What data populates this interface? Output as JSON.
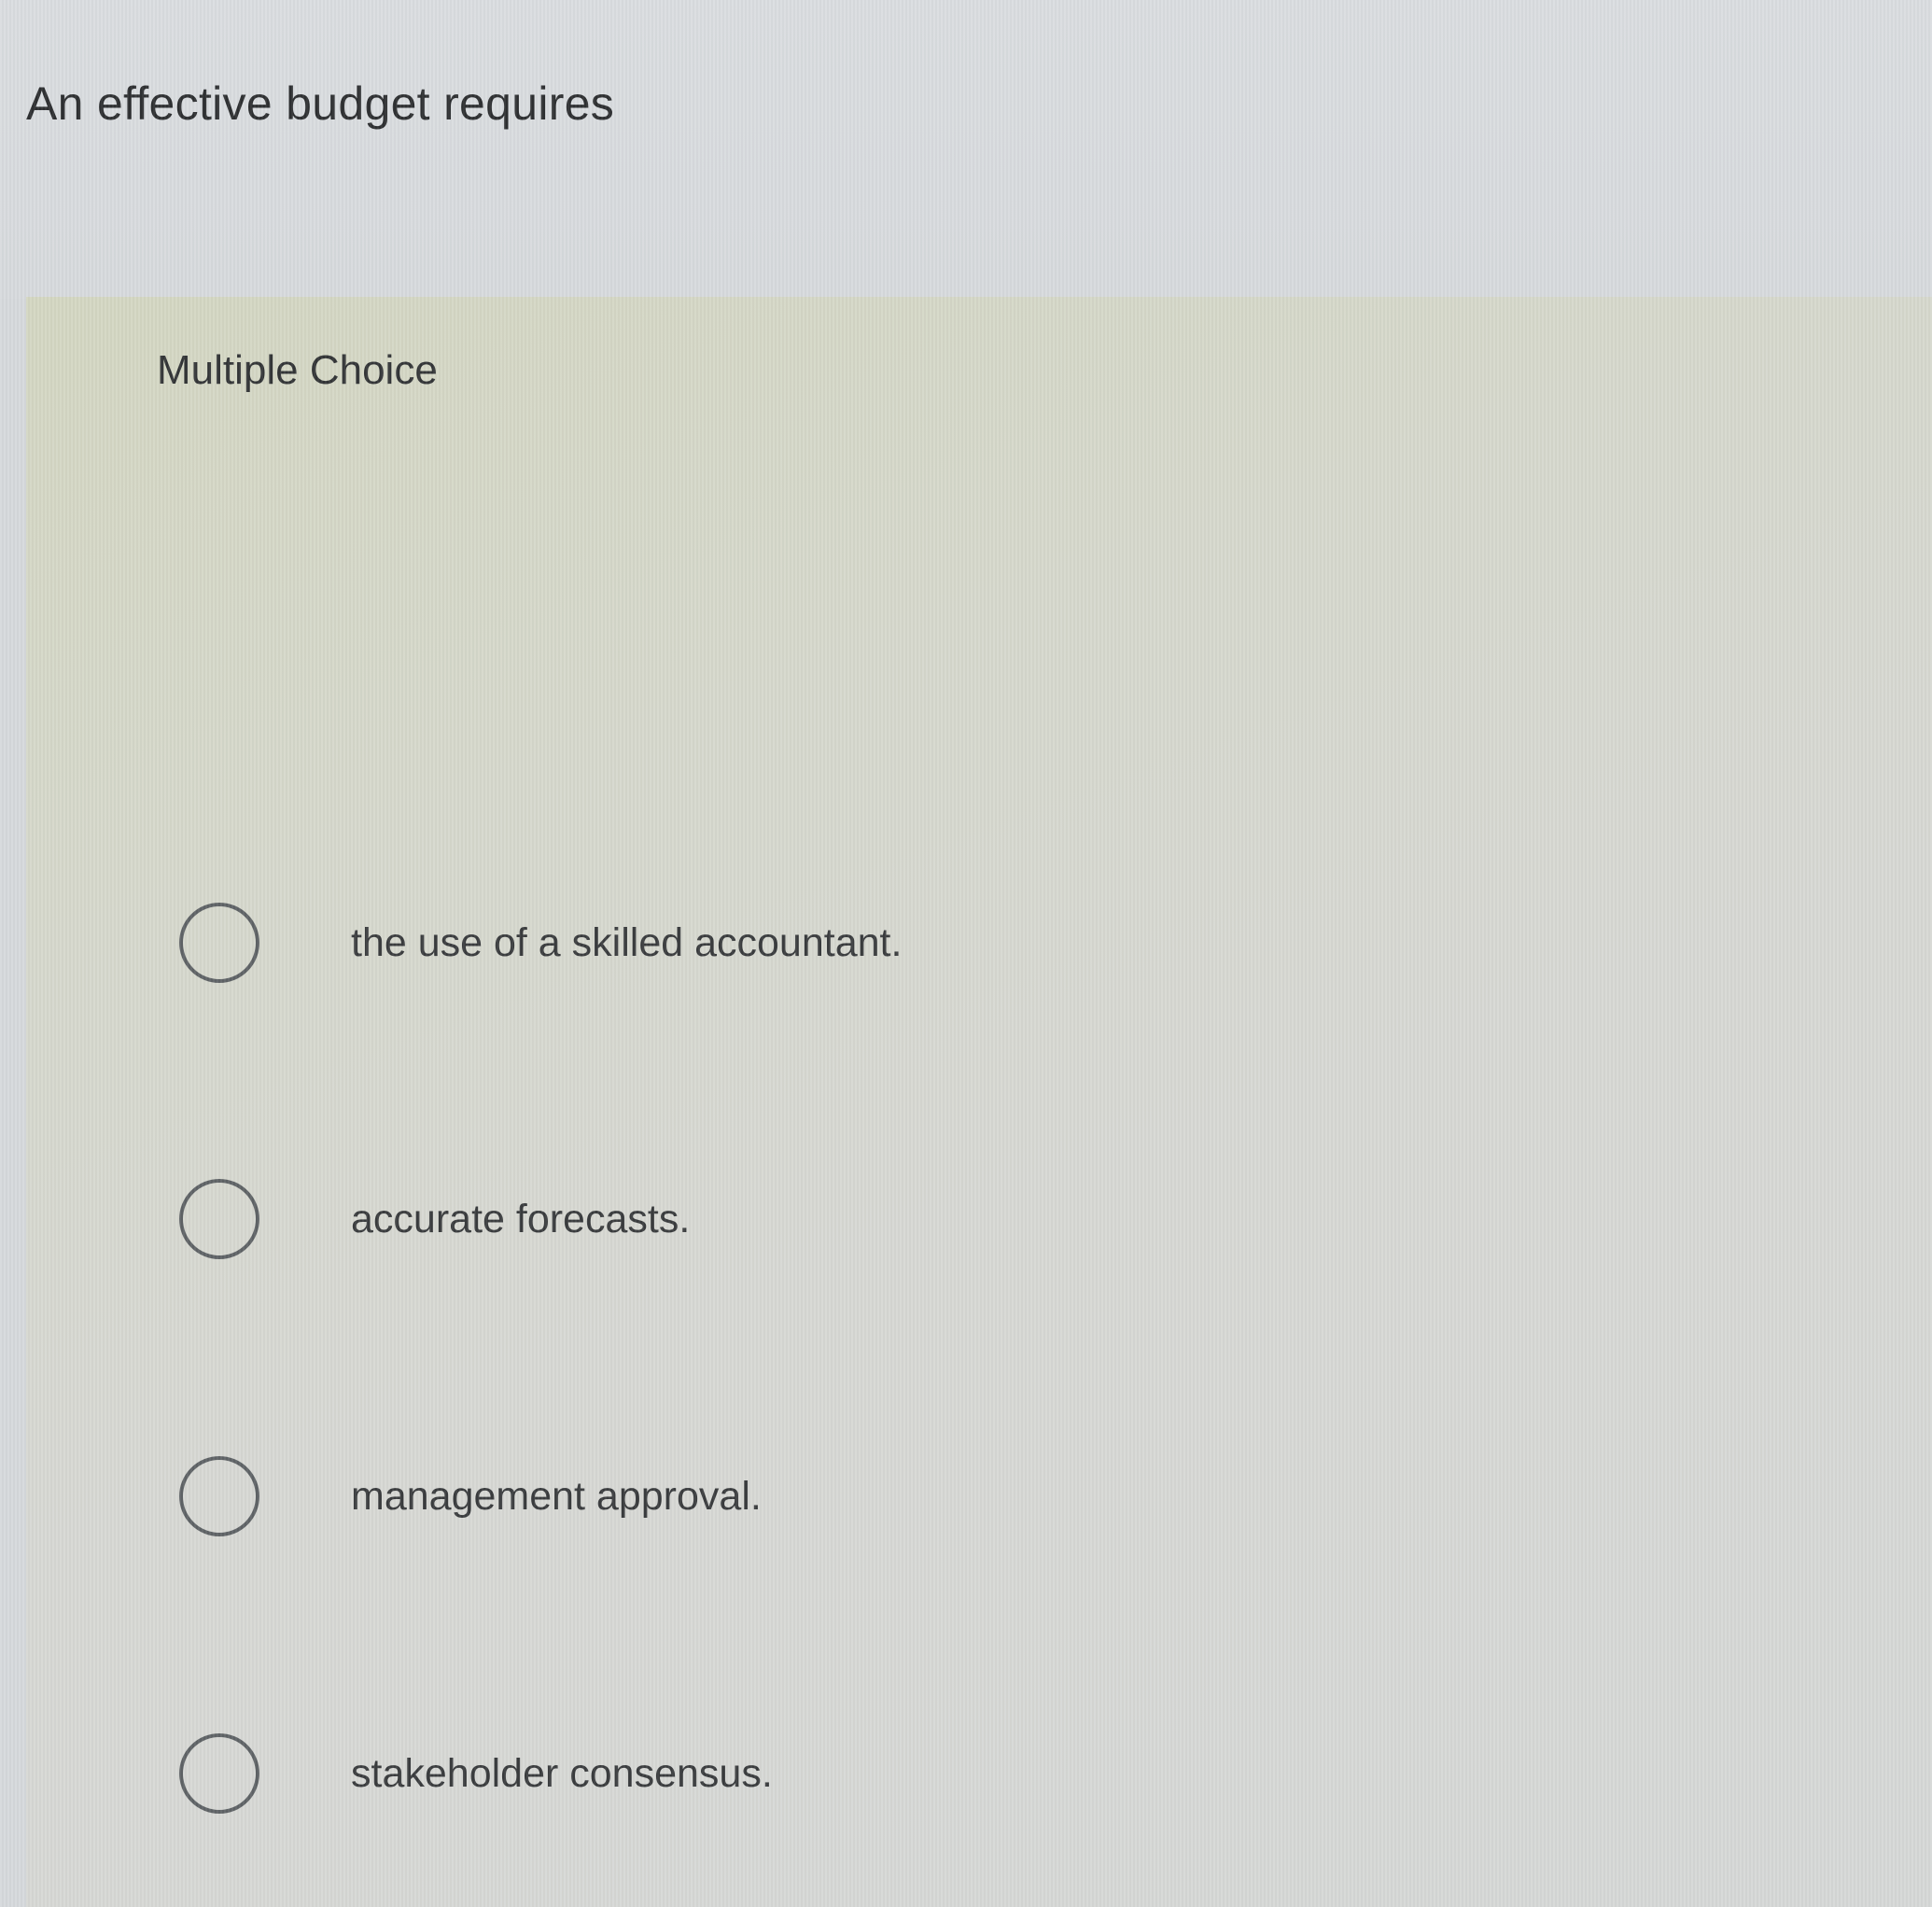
{
  "question": {
    "prompt": "An effective budget requires",
    "type_label": "Multiple Choice"
  },
  "options": [
    {
      "label": "the use of a skilled accountant.",
      "selected": false
    },
    {
      "label": "accurate forecasts.",
      "selected": false
    },
    {
      "label": "management approval.",
      "selected": false
    },
    {
      "label": "stakeholder consensus.",
      "selected": false
    }
  ],
  "colors": {
    "header_background": "#d7dadd",
    "panel_background": "#d6d8cd",
    "text": "#2f3133",
    "radio_border": "#5f6366"
  }
}
